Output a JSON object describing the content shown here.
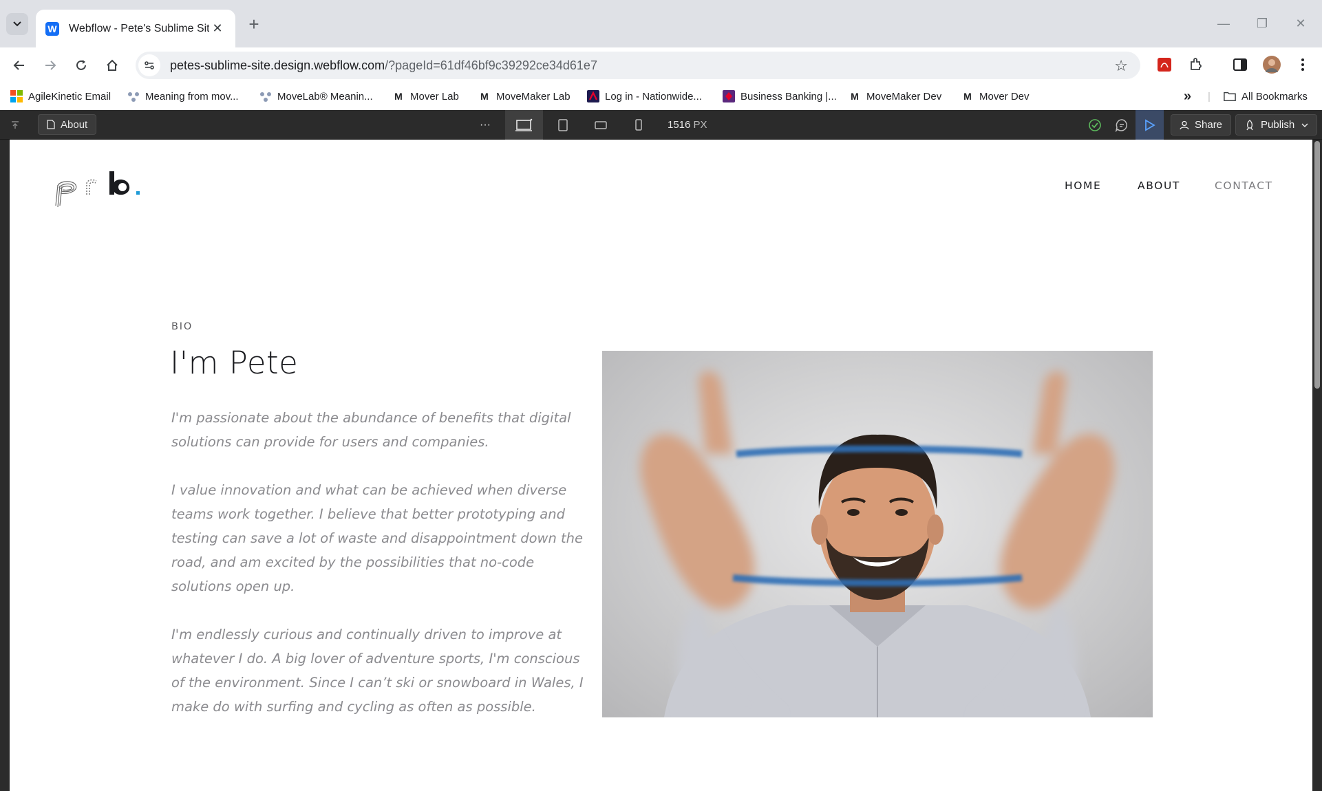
{
  "browser": {
    "tab_title": "Webflow - Pete's Sublime Site",
    "url_host": "petes-sublime-site.design.webflow.com",
    "url_path": "/?pageId=61df46bf9c39292ce34d61e7",
    "bookmarks": [
      {
        "label": "AgileKinetic Email",
        "icon": "microsoft-icon"
      },
      {
        "label": "Meaning from mov...",
        "icon": "movelab-icon"
      },
      {
        "label": "MoveLab® Meanin...",
        "icon": "movelab-icon"
      },
      {
        "label": "Mover Lab",
        "icon": "m-icon"
      },
      {
        "label": "MoveMaker Lab",
        "icon": "m-icon"
      },
      {
        "label": "Log in - Nationwide...",
        "icon": "nationwide-icon"
      },
      {
        "label": "Business Banking |...",
        "icon": "natwest-icon"
      },
      {
        "label": "MoveMaker Dev",
        "icon": "m-icon"
      },
      {
        "label": "Mover Dev",
        "icon": "m-icon"
      }
    ],
    "all_bookmarks": "All Bookmarks"
  },
  "webflow": {
    "page_name": "About",
    "more": "···",
    "width_value": "1516",
    "width_unit": "PX",
    "share": "Share",
    "publish": "Publish"
  },
  "site": {
    "nav": [
      "HOME",
      "ABOUT",
      "CONTACT"
    ],
    "eyebrow": "BIO",
    "heading": "I'm Pete",
    "paragraphs": [
      "I'm passionate about the abundance of benefits that digital solutions can provide for users and companies.",
      "I value innovation and what can be achieved when diverse teams work together. I believe that better prototyping and testing can save a lot of waste and disappointment down the road, and am excited by the possibilities that no-code solutions open up.",
      "I'm endlessly curious and continually driven to improve at whatever I do. A big lover of adventure sports, I'm conscious of the environment. Since I can’t ski or snowboard in Wales, I make do with surfing and cycling as often as possible."
    ]
  },
  "colors": {
    "accent_blue": "#1e9bd7",
    "webflow_bar": "#2b2b2b",
    "body_text": "#8b8b8f"
  }
}
